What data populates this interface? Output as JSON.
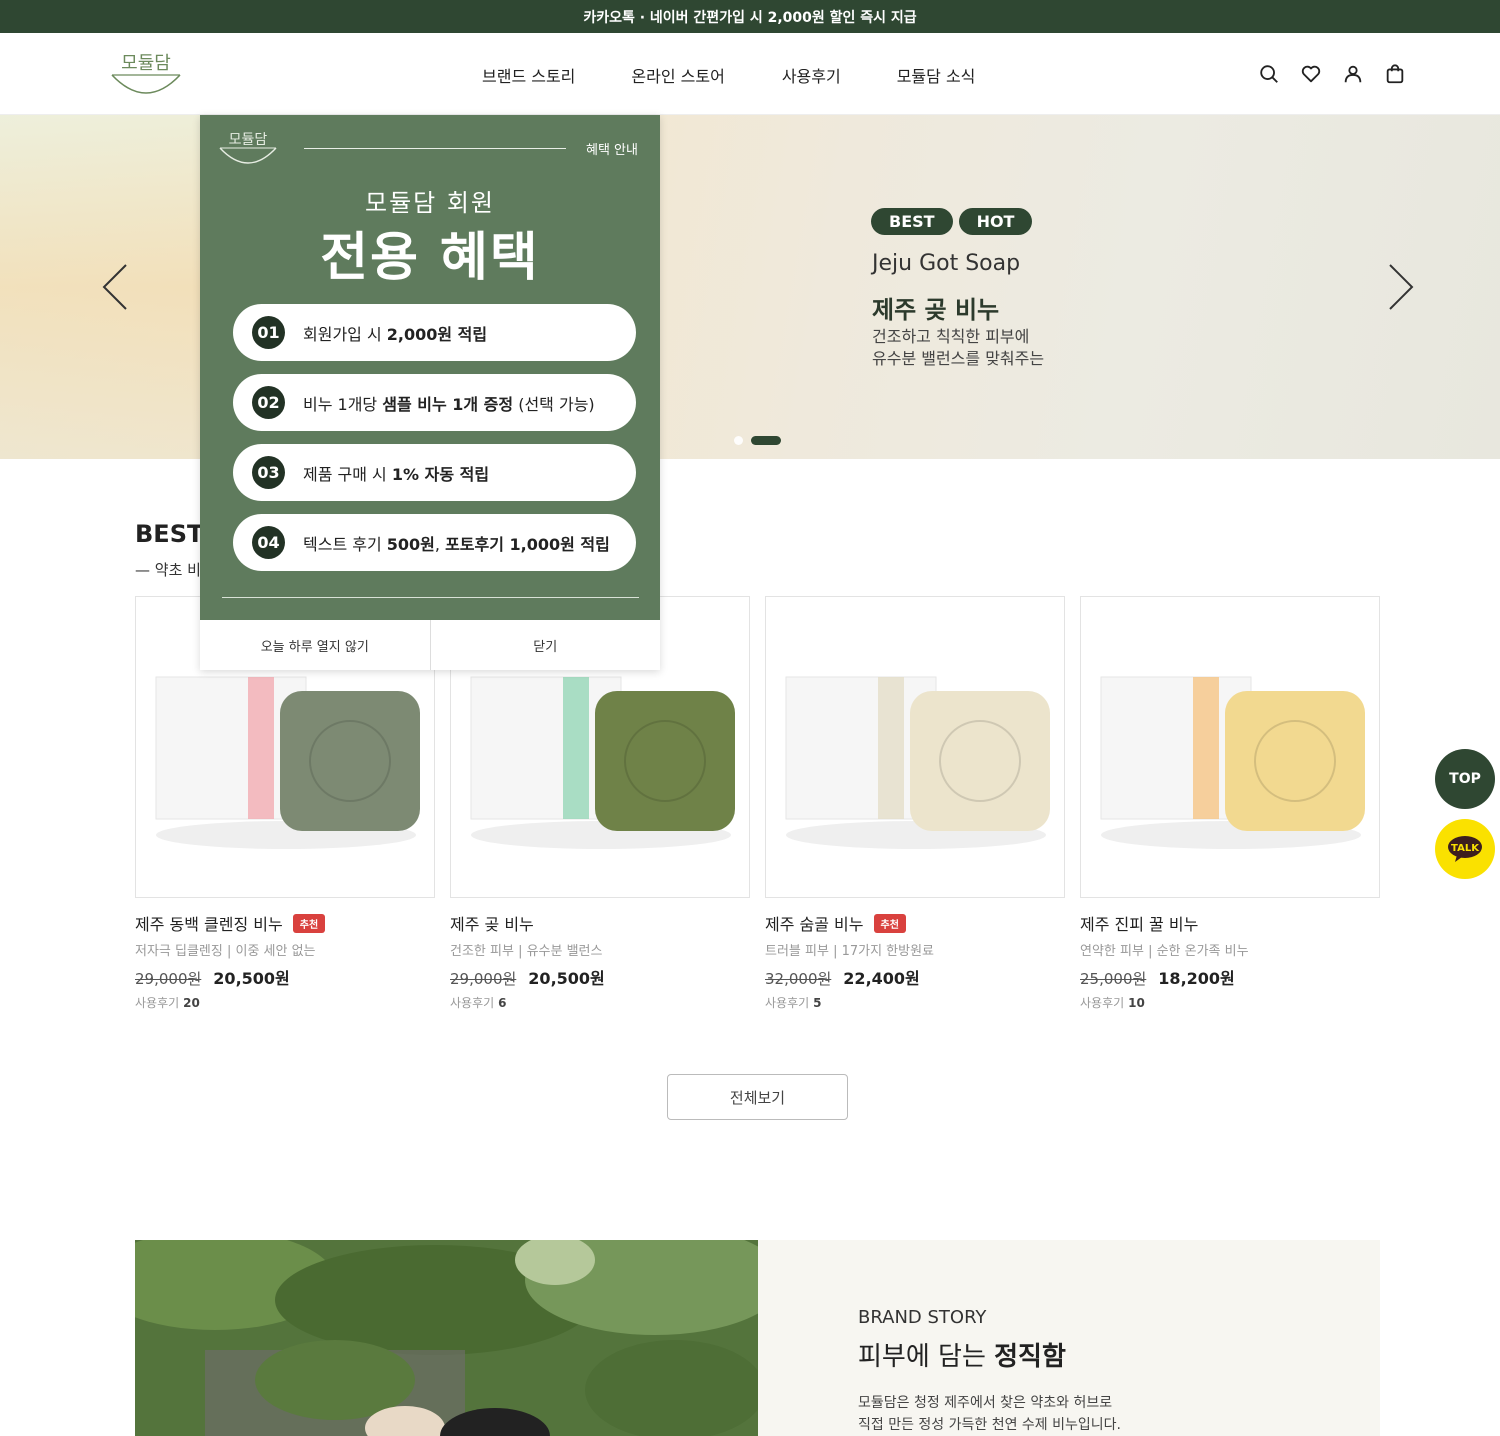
{
  "topbar": {
    "text": "카카오톡 · 네이버 간편가입 시 2,000원 할인 즉시 지급"
  },
  "header": {
    "logo_text": "모듈담",
    "nav": [
      "브랜드 스토리",
      "온라인 스토어",
      "사용후기",
      "모듈담 소식"
    ],
    "icons": [
      "search-icon",
      "heart-icon",
      "user-icon",
      "cart-icon"
    ]
  },
  "hero": {
    "badges": [
      "BEST",
      "HOT"
    ],
    "title_en": "Jeju Got Soap",
    "title_ko": "제주 곶 비누",
    "desc_line1": "건조하고 칙칙한 피부에",
    "desc_line2": "유수분 밸런스를 맞춰주는",
    "slide_count": 2,
    "active_slide": 2
  },
  "best": {
    "title": "BEST",
    "subtitle": "— 약초 비",
    "products": [
      {
        "name": "제주 동백 클렌징 비누",
        "recommended": true,
        "rec_label": "추천",
        "desc": "저자극 딥클렌징 | 이중 세안 없는",
        "old_price": "29,000원",
        "price": "20,500원",
        "review_label": "사용후기",
        "review_count": "20",
        "soap_color": "#7d8a73",
        "stripe_color": "#f2a7ae"
      },
      {
        "name": "제주 곶 비누",
        "recommended": false,
        "rec_label": "",
        "desc": "건조한 피부 | 유수분 밸런스",
        "old_price": "29,000원",
        "price": "20,500원",
        "review_label": "사용후기",
        "review_count": "6",
        "soap_color": "#6f8248",
        "stripe_color": "#8fd4b3"
      },
      {
        "name": "제주 숨골 비누",
        "recommended": true,
        "rec_label": "추천",
        "desc": "트러블 피부 | 17가지 한방원료",
        "old_price": "32,000원",
        "price": "22,400원",
        "review_label": "사용후기",
        "review_count": "5",
        "soap_color": "#ece4cc",
        "stripe_color": "#e3dcc6"
      },
      {
        "name": "제주 진피 꿀 비누",
        "recommended": false,
        "rec_label": "",
        "desc": "연약한 피부 | 순한 온가족 비누",
        "old_price": "25,000원",
        "price": "18,200원",
        "review_label": "사용후기",
        "review_count": "10",
        "soap_color": "#f2d990",
        "stripe_color": "#f6c27d"
      }
    ],
    "view_all": "전체보기"
  },
  "floating": {
    "top": "TOP",
    "talk": "TALK"
  },
  "brand": {
    "label": "BRAND STORY",
    "title_normal": "피부에 담는 ",
    "title_bold": "정직함",
    "desc_line1": "모듈담은 청정 제주에서 찾은 약초와 허브로",
    "desc_line2": "직접 만든 정성 가득한 천연 수제 비누입니다."
  },
  "popup": {
    "logo_text": "모듈담",
    "benefit_label": "혜택 안내",
    "subtitle": "모듈담 회원",
    "title": "전용 혜택",
    "items": [
      {
        "num": "01",
        "pre": "회원가입 시 ",
        "bold": "2,000원 적립",
        "post": ""
      },
      {
        "num": "02",
        "pre": "비누 1개당 ",
        "bold": "샘플 비누 1개 증정",
        "post": " (선택 가능)"
      },
      {
        "num": "03",
        "pre": "제품 구매 시 ",
        "bold": "1% 자동 적립",
        "post": ""
      },
      {
        "num": "04",
        "pre": "텍스트 후기 ",
        "bold": "500원",
        "post": ", ",
        "bold2": "포토후기 1,000원 적립"
      }
    ],
    "btn_no_today": "오늘 하루 열지 않기",
    "btn_close": "닫기"
  },
  "colors": {
    "brand_green": "#2f4732",
    "popup_green": "#5f7b5d",
    "rec_red": "#d9413e",
    "kakao_yellow": "#fae100"
  }
}
